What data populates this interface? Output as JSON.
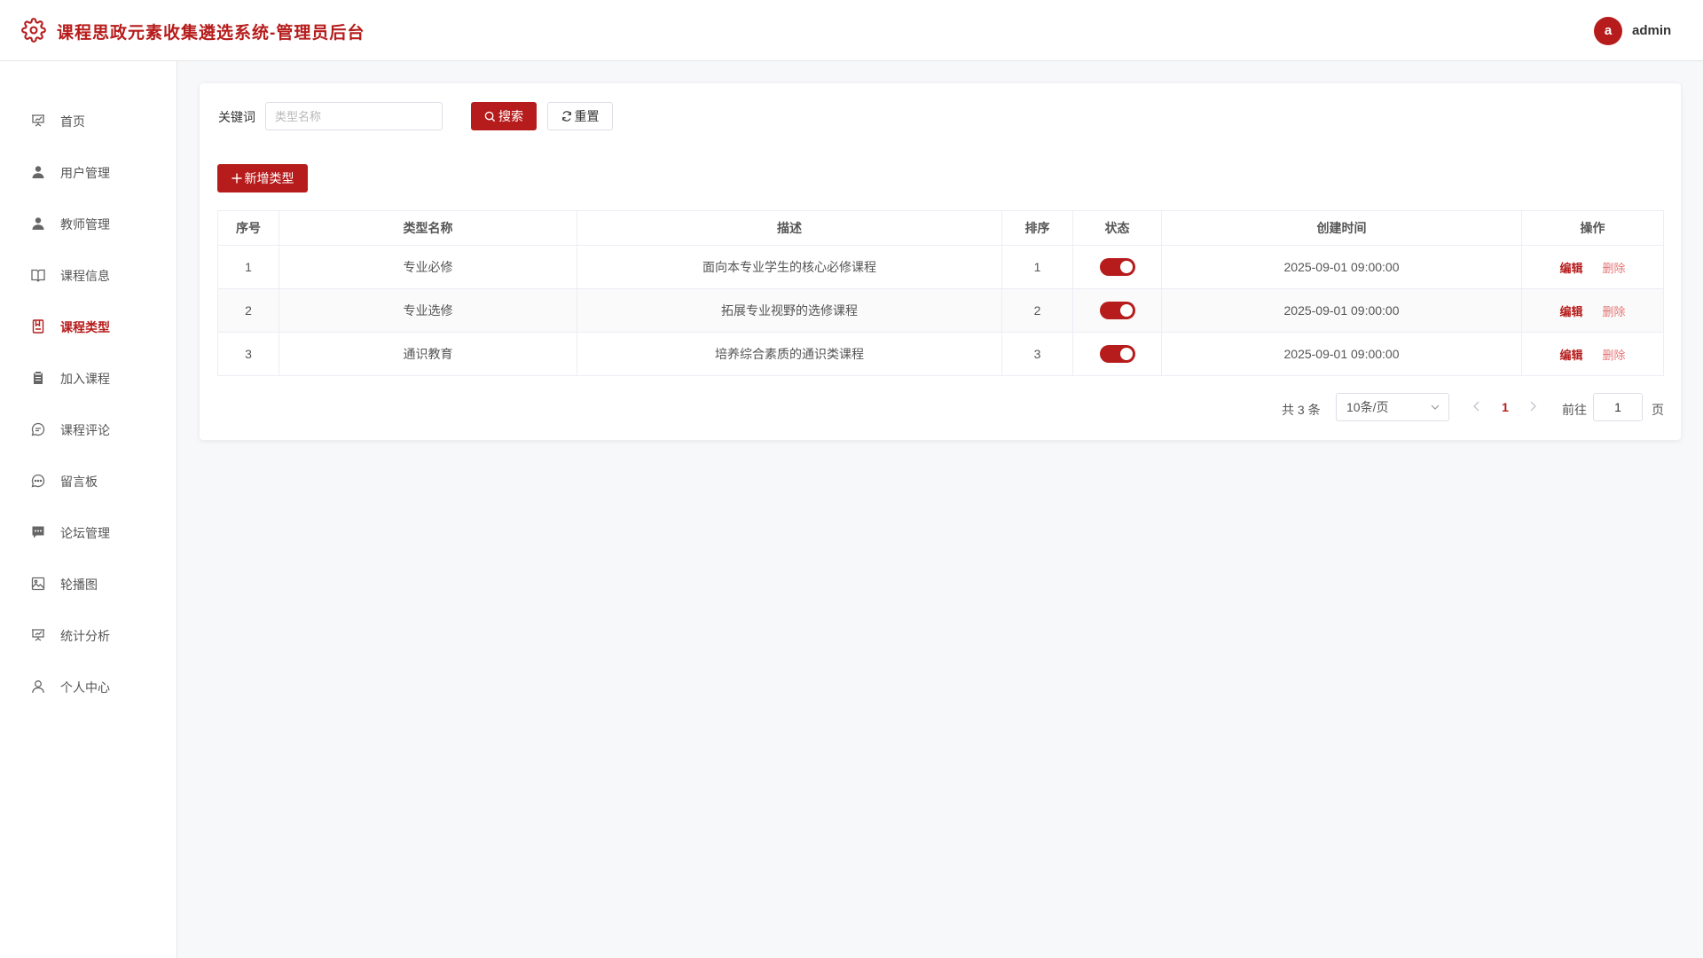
{
  "header": {
    "title": "课程思政元素收集遴选系统-管理员后台",
    "avatar_letter": "a",
    "username": "admin",
    "accent_color": "#b71c1c"
  },
  "sidebar": {
    "items": [
      {
        "label": "首页",
        "icon": "presentation-icon"
      },
      {
        "label": "用户管理",
        "icon": "user-icon"
      },
      {
        "label": "教师管理",
        "icon": "user-icon"
      },
      {
        "label": "课程信息",
        "icon": "book-icon"
      },
      {
        "label": "课程类型",
        "icon": "notebook-icon",
        "active": true
      },
      {
        "label": "加入课程",
        "icon": "clipboard-icon"
      },
      {
        "label": "课程评论",
        "icon": "chat-icon"
      },
      {
        "label": "留言板",
        "icon": "chat-dots-icon"
      },
      {
        "label": "论坛管理",
        "icon": "message-icon"
      },
      {
        "label": "轮播图",
        "icon": "image-icon"
      },
      {
        "label": "统计分析",
        "icon": "presentation-icon"
      },
      {
        "label": "个人中心",
        "icon": "user-outline-icon"
      }
    ]
  },
  "search": {
    "label": "关键词",
    "placeholder": "类型名称",
    "value": "",
    "search_label": "搜索",
    "reset_label": "重置"
  },
  "toolbar": {
    "add_label": "新增类型"
  },
  "table": {
    "columns": [
      "序号",
      "类型名称",
      "描述",
      "排序",
      "状态",
      "创建时间",
      "操作"
    ],
    "rows": [
      {
        "index": "1",
        "name": "专业必修",
        "desc": "面向本专业学生的核心必修课程",
        "sort": "1",
        "status": true,
        "created": "2025-09-01 09:00:00"
      },
      {
        "index": "2",
        "name": "专业选修",
        "desc": "拓展专业视野的选修课程",
        "sort": "2",
        "status": true,
        "created": "2025-09-01 09:00:00"
      },
      {
        "index": "3",
        "name": "通识教育",
        "desc": "培养综合素质的通识类课程",
        "sort": "3",
        "status": true,
        "created": "2025-09-01 09:00:00"
      }
    ],
    "edit_label": "编辑",
    "delete_label": "删除"
  },
  "pagination": {
    "total_text": "共 3 条",
    "page_size": "10条/页",
    "current_page": "1",
    "goto_label": "前往",
    "goto_value": "1",
    "page_suffix": "页"
  }
}
